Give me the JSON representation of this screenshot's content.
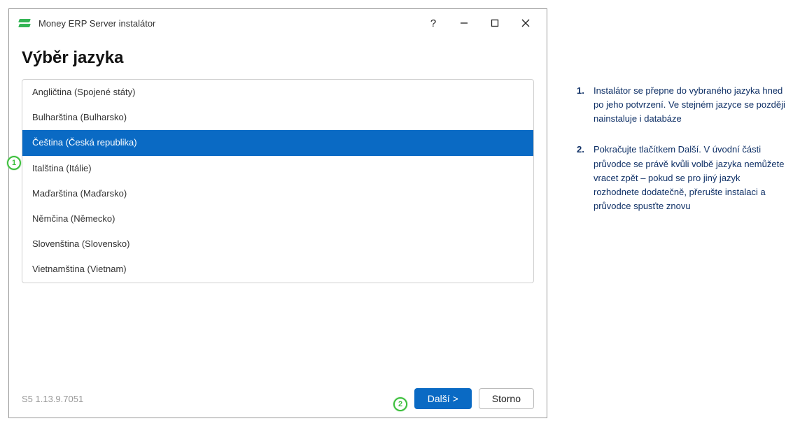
{
  "window": {
    "title": "Money ERP Server instalátor"
  },
  "page": {
    "heading": "Výběr jazyka"
  },
  "languages": {
    "items": [
      {
        "label": "Angličtina (Spojené státy)",
        "selected": false
      },
      {
        "label": "Bulharština (Bulharsko)",
        "selected": false
      },
      {
        "label": "Čeština (Česká republika)",
        "selected": true
      },
      {
        "label": "Italština (Itálie)",
        "selected": false
      },
      {
        "label": "Maďarština (Maďarsko)",
        "selected": false
      },
      {
        "label": "Němčina (Německo)",
        "selected": false
      },
      {
        "label": "Slovenština (Slovensko)",
        "selected": false
      },
      {
        "label": "Vietnamština (Vietnam)",
        "selected": false
      }
    ]
  },
  "footer": {
    "version": "S5 1.13.9.7051",
    "next_label": "Další >",
    "cancel_label": "Storno"
  },
  "callouts": {
    "c1": "1",
    "c2": "2"
  },
  "notes": {
    "n1_num": "1.",
    "n1_text": "Instalátor se přepne do vybraného jazyka hned po jeho potvrzení. Ve stejném jazyce se později nainstaluje i databáze",
    "n2_num": "2.",
    "n2_text": "Pokračujte tlačítkem Další. V úvodní části průvodce se právě kvůli volbě jazyka nemůžete vracet zpět – pokud se pro jiný jazyk rozhodnete dodatečně, přerušte instalaci a průvodce spusťte znovu"
  }
}
